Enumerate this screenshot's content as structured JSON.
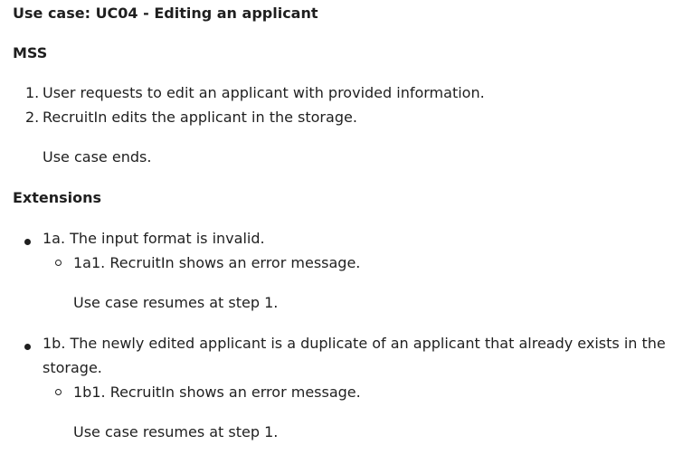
{
  "title": "Use case: UC04 - Editing an applicant",
  "mss": {
    "heading": "MSS",
    "steps": [
      {
        "num": "1.",
        "text": "User requests to edit an applicant with provided information."
      },
      {
        "num": "2.",
        "text": "RecruitIn edits the applicant in the storage."
      }
    ],
    "end_note": "Use case ends."
  },
  "extensions": {
    "heading": "Extensions",
    "items": [
      {
        "text_line1": "1a. The input format is invalid.",
        "text_line2": "",
        "sub": "1a1. RecruitIn shows an error message.",
        "note": "Use case resumes at step 1."
      },
      {
        "text_line1": "1b. The newly edited applicant is a duplicate of an applicant that already exists in the",
        "text_line2": "storage.",
        "sub": "1b1. RecruitIn shows an error message.",
        "note": "Use case resumes at step 1."
      }
    ]
  }
}
